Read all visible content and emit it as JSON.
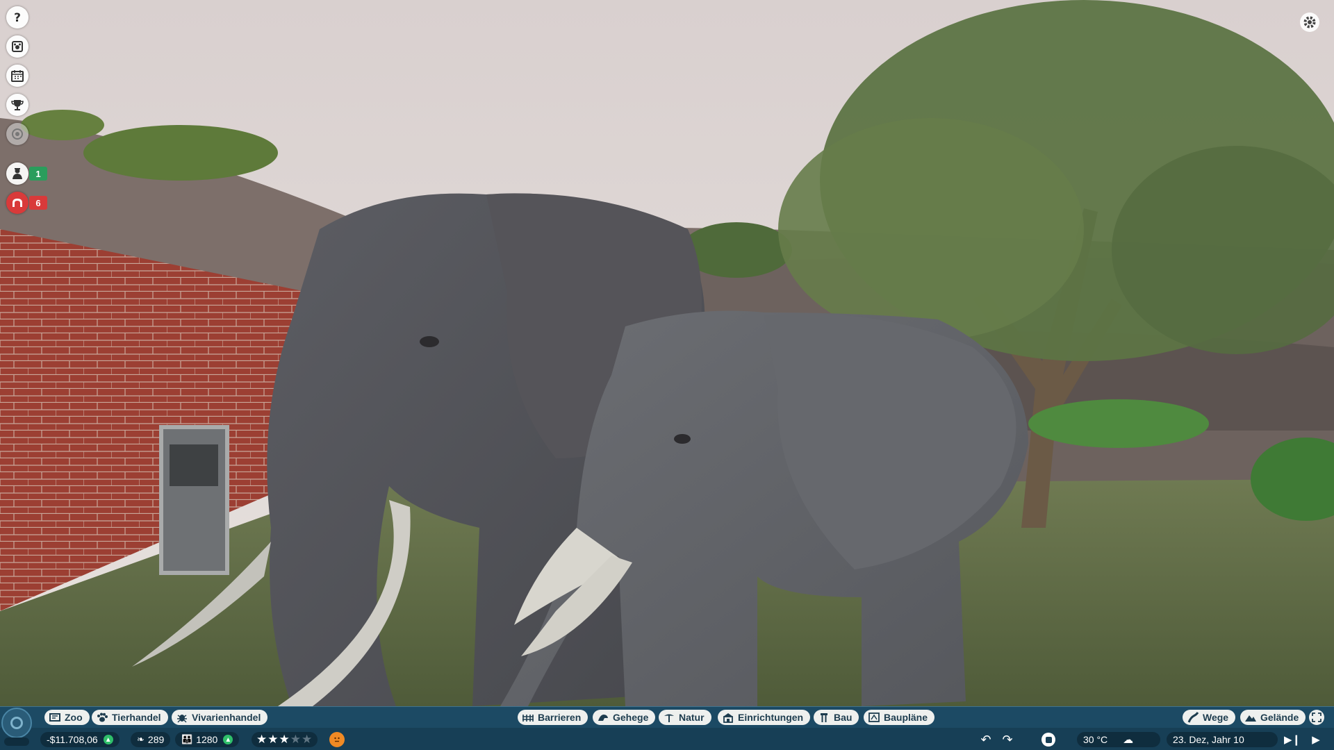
{
  "left_icons": [
    {
      "name": "help-icon"
    },
    {
      "name": "animal-info-icon"
    },
    {
      "name": "calendar-icon"
    },
    {
      "name": "trophy-icon"
    },
    {
      "name": "view-icon"
    }
  ],
  "notifications": [
    {
      "name": "staff-notification",
      "count": "1",
      "color": "#2a9d5c"
    },
    {
      "name": "alert-notification",
      "count": "6",
      "color": "#d93a3a"
    }
  ],
  "toolbar": {
    "left": [
      {
        "label": "Zoo",
        "icon": "zoo-icon"
      },
      {
        "label": "Tierhandel",
        "icon": "paw-icon"
      },
      {
        "label": "Vivarienhandel",
        "icon": "bug-icon"
      }
    ],
    "center": [
      {
        "label": "Barrieren",
        "icon": "barrier-icon"
      },
      {
        "label": "Gehege",
        "icon": "habitat-icon"
      },
      {
        "label": "Natur",
        "icon": "nature-icon"
      },
      {
        "label": "Einrichtungen",
        "icon": "facility-icon"
      },
      {
        "label": "Bau",
        "icon": "build-icon"
      },
      {
        "label": "Baupläne",
        "icon": "blueprint-icon"
      }
    ],
    "right": [
      {
        "label": "Wege",
        "icon": "path-icon"
      },
      {
        "label": "Gelände",
        "icon": "terrain-icon"
      }
    ]
  },
  "status": {
    "money": "-$11.708,06",
    "conservation": "289",
    "guests": "1280",
    "rating_stars": 3,
    "rating_max": 5,
    "temperature": "30 °C",
    "date": "23. Dez, Jahr 10"
  },
  "colors": {
    "bar": "#1c4a64",
    "pill": "#eef0ee",
    "accent_green": "#2fbf6a",
    "mood": "#f08a24"
  }
}
